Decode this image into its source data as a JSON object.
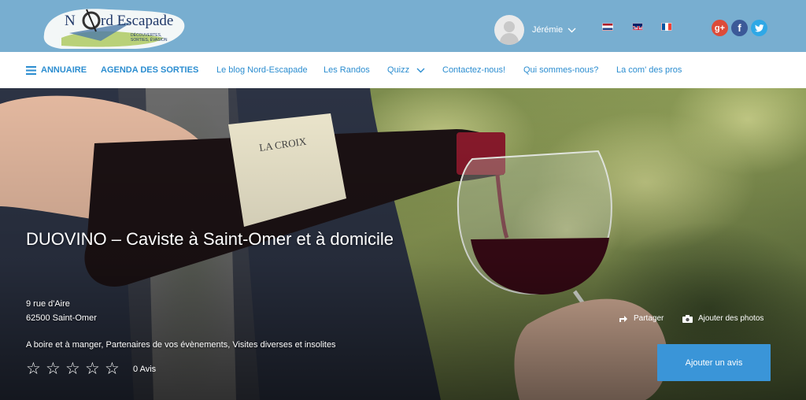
{
  "header": {
    "logo_text": "Nord Escapade",
    "logo_tagline": "DÉCOUVERTES, SORTIES, ÉVASION",
    "user_name": "Jérémie",
    "languages": [
      "nl",
      "en",
      "fr"
    ],
    "social": [
      {
        "name": "google-plus",
        "label": "g+",
        "color": "#dd4b39"
      },
      {
        "name": "facebook",
        "label": "f",
        "color": "#3b5998"
      },
      {
        "name": "twitter",
        "label": "t",
        "color": "#2fa8e6"
      }
    ]
  },
  "nav": {
    "items": [
      {
        "label": "ANNUAIRE"
      },
      {
        "label": "AGENDA DES SORTIES"
      },
      {
        "label": "Le blog Nord-Escapade"
      },
      {
        "label": "Les Randos"
      },
      {
        "label": "Quizz"
      },
      {
        "label": "Contactez-nous!"
      },
      {
        "label": "Qui sommes-nous?"
      },
      {
        "label": "La com' des pros"
      }
    ]
  },
  "listing": {
    "title": "DUOVINO – Caviste à Saint-Omer et à domicile",
    "address_line1": "9 rue d'Aire",
    "address_line2": "62500 Saint-Omer",
    "categories": "A boire et à manger, Partenaires de vos évènements, Visites diverses et insolites",
    "rating": 0,
    "reviews_label": "0 Avis",
    "share_label": "Partager",
    "add_photos_label": "Ajouter des photos",
    "add_review_label": "Ajouter un avis"
  },
  "colors": {
    "header_bg": "#78aed0",
    "nav_text": "#2b8dd0",
    "button_bg": "#3a95d8"
  }
}
